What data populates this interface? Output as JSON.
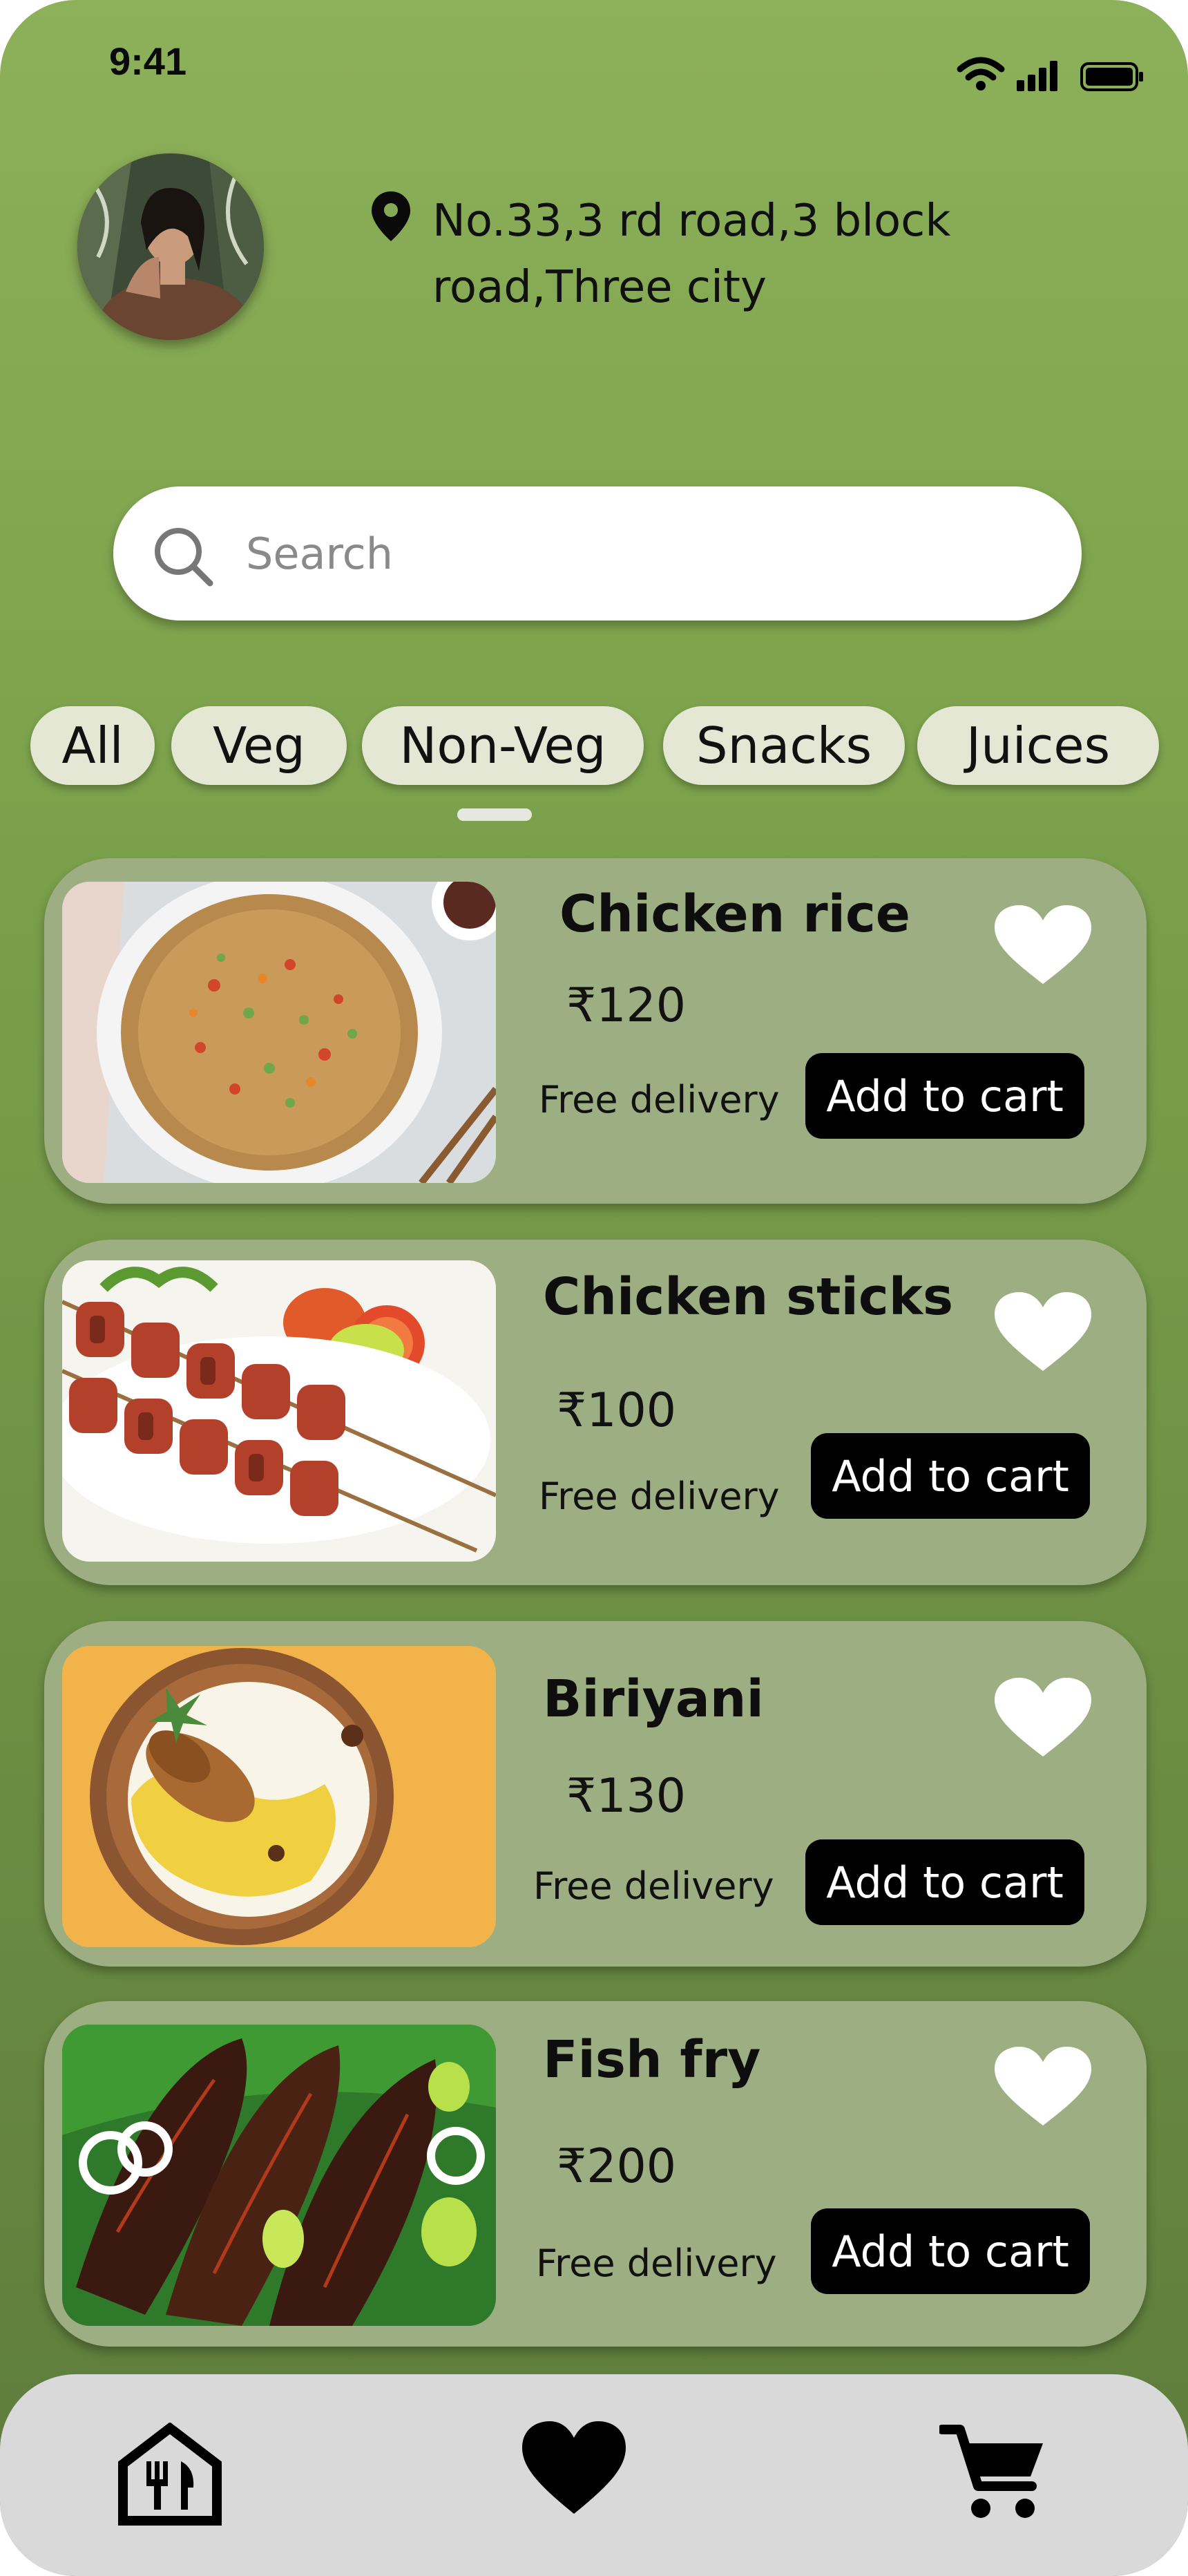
{
  "status_bar": {
    "time": "9:41"
  },
  "header": {
    "address": "No.33,3 rd road,3 block road,Three city",
    "location_icon": "location-pin-icon",
    "avatar_icon": "user-avatar"
  },
  "search": {
    "placeholder": "Search",
    "value": ""
  },
  "categories": [
    {
      "label": "All"
    },
    {
      "label": "Veg"
    },
    {
      "label": "Non-Veg"
    },
    {
      "label": "Snacks"
    },
    {
      "label": "Juices"
    }
  ],
  "items": [
    {
      "name": "Chicken rice",
      "price": "₹120",
      "delivery": "Free delivery",
      "button": "Add to cart",
      "favorite_icon": "heart-icon"
    },
    {
      "name": "Chicken sticks",
      "price": "₹100",
      "delivery": "Free delivery",
      "button": "Add to cart",
      "favorite_icon": "heart-icon"
    },
    {
      "name": "Biriyani",
      "price": "₹130",
      "delivery": "Free delivery",
      "button": "Add to cart",
      "favorite_icon": "heart-icon"
    },
    {
      "name": "Fish fry",
      "price": "₹200",
      "delivery": "Free delivery",
      "button": "Add to cart",
      "favorite_icon": "heart-icon"
    }
  ],
  "bottom_nav": {
    "items": [
      "home-icon",
      "favorites-heart-icon",
      "cart-icon"
    ]
  },
  "colors": {
    "background_top": "#8db05a",
    "background_bottom": "#5d7b3c",
    "card": "#9cae82",
    "chip": "#e3e7d3",
    "button": "#000000",
    "nav_bar": "#d9d9d9"
  }
}
